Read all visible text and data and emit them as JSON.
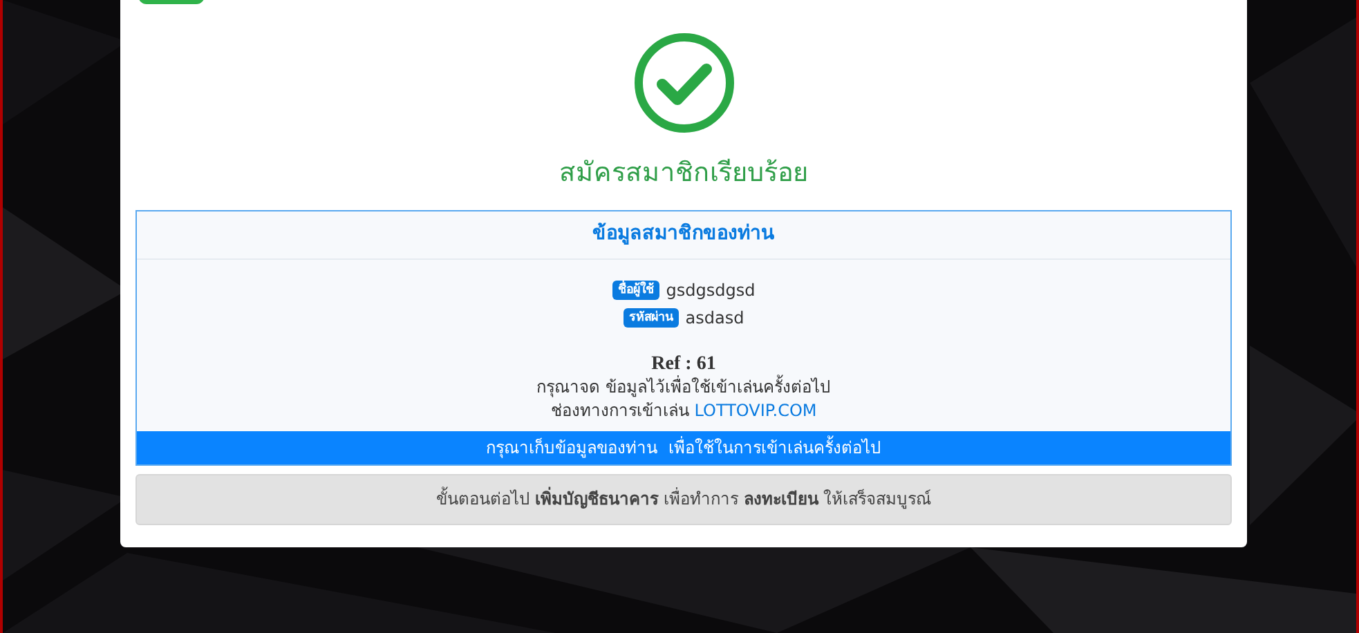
{
  "status": {
    "title": "สมัครสมาชิกเรียบร้อย"
  },
  "info_panel": {
    "heading": "ข้อมูลสมาชิกของท่าน",
    "credentials": [
      {
        "badge": "ชื่อผู้ใช้",
        "value": "gsdgsdgsd"
      },
      {
        "badge": "รหัสผ่าน",
        "value": "asdasd"
      }
    ],
    "ref": "Ref : 61",
    "note": "กรุณาจด ข้อมูลไว้เพื่อใช้เข้าเล่นครั้งต่อไป",
    "channel_label": "ช่องทางการเข้าเล่น",
    "channel_link": "LOTTOVIP.COM",
    "banner": "กรุณาเก็บข้อมูลของท่าน  เพื่อใช้ในการเข้าเล่นครั้งต่อไป"
  },
  "next_step": "ขั้นตอนต่อไป **เพิ่มบัญชีธนาคาร** เพื่อทำการ **ลงทะเบียน** ให้เสร็จสมบูรณ์"
}
